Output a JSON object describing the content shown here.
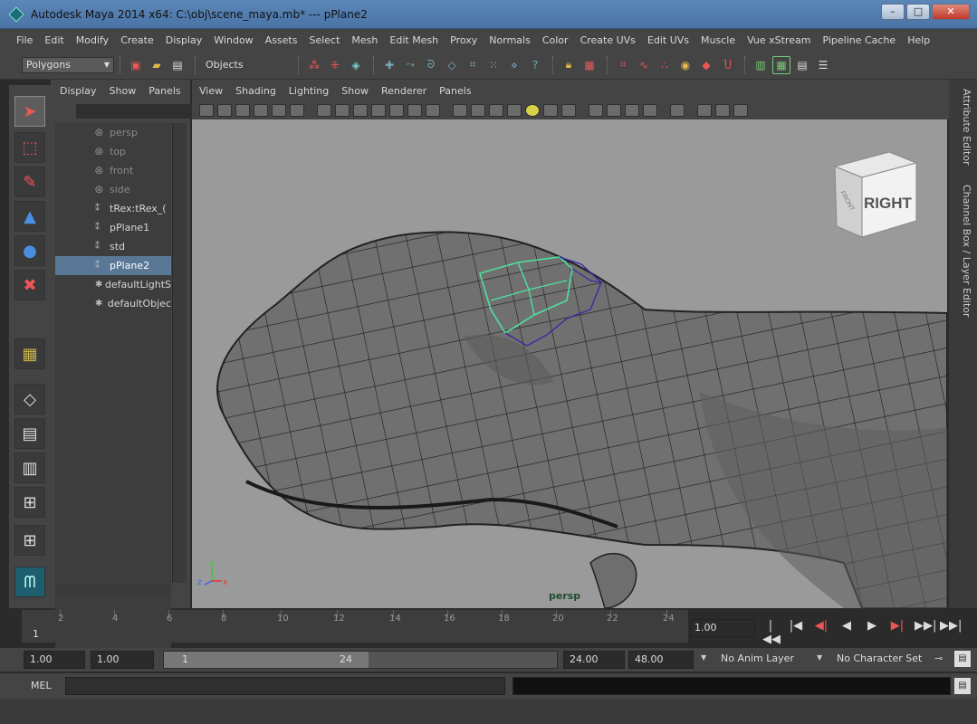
{
  "window": {
    "title": "Autodesk Maya 2014 x64: C:\\obj\\scene_maya.mb*   ---   pPlane2"
  },
  "menus": [
    "File",
    "Edit",
    "Modify",
    "Create",
    "Display",
    "Window",
    "Assets",
    "Select",
    "Mesh",
    "Edit Mesh",
    "Proxy",
    "Normals",
    "Color",
    "Create UVs",
    "Edit UVs",
    "Muscle",
    "Vue xStream",
    "Pipeline Cache",
    "Help"
  ],
  "toolbar": {
    "menuset": "Polygons",
    "selection_mode": "Objects"
  },
  "outliner": {
    "menus": [
      "Display",
      "Show",
      "Panels"
    ],
    "items": [
      {
        "label": "persp",
        "dim": true
      },
      {
        "label": "top",
        "dim": true
      },
      {
        "label": "front",
        "dim": true
      },
      {
        "label": "side",
        "dim": true
      },
      {
        "label": "tRex:tRex_(",
        "dim": false
      },
      {
        "label": "pPlane1",
        "dim": false
      },
      {
        "label": "std",
        "dim": false
      },
      {
        "label": "pPlane2",
        "dim": false,
        "selected": true
      },
      {
        "label": "defaultLightS",
        "dim": false
      },
      {
        "label": "defaultObjec",
        "dim": false
      }
    ]
  },
  "viewport": {
    "menus": [
      "View",
      "Shading",
      "Lighting",
      "Show",
      "Renderer",
      "Panels"
    ],
    "camera_label": "persp",
    "viewcube_face": "RIGHT",
    "viewcube_side_label": "FRONT",
    "axes": {
      "y": "y",
      "x": "x",
      "z": "z"
    }
  },
  "right_dock": {
    "attribute_editor": "Attribute Editor",
    "channel_box": "Channel Box / Layer Editor"
  },
  "timeline": {
    "ticks": [
      "2",
      "4",
      "6",
      "8",
      "10",
      "12",
      "14",
      "16",
      "18",
      "20",
      "22",
      "24"
    ],
    "current_frame": "1",
    "current_time": "1.00",
    "playback_icons": [
      "|◀◀",
      "|◀",
      "◀|",
      "◀",
      "▶",
      "▶|",
      "▶▶|",
      "▶▶|"
    ]
  },
  "range": {
    "start": "1.00",
    "anim_start": "1.00",
    "slider_start": "1",
    "slider_end": "24",
    "end": "24.00",
    "anim_end": "48.00",
    "anim_layer": "No Anim Layer",
    "character_set": "No Character Set"
  },
  "command": {
    "label": "MEL"
  },
  "colors": {
    "viewport_bg": "#9a9a9a",
    "selection": "#5a7896",
    "wire_selected": "#4fe0a0",
    "wire_highlight": "#3a2aa0"
  }
}
